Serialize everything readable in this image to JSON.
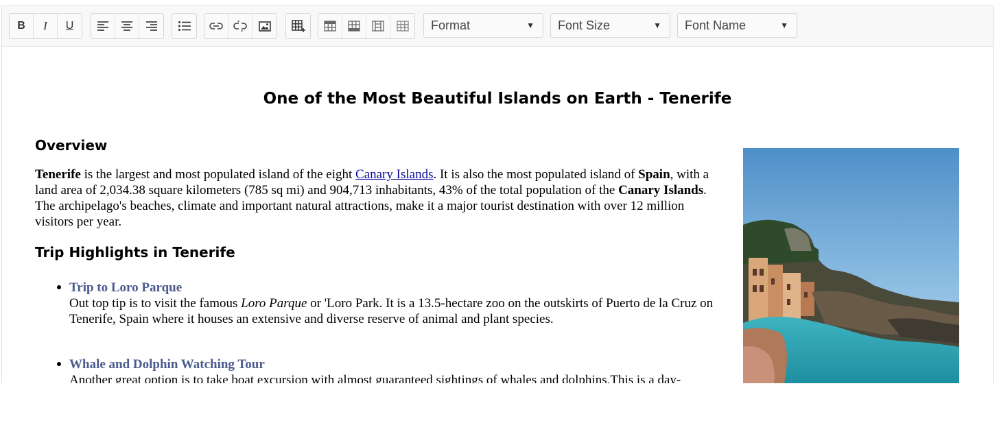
{
  "toolbar": {
    "format": {
      "label": "Format"
    },
    "font_size": {
      "label": "Font Size"
    },
    "font_name": {
      "label": "Font Name"
    },
    "buttons": {
      "bold": "B",
      "italic": "I",
      "underline": "U"
    }
  },
  "doc": {
    "title": "One of the Most Beautiful Islands on Earth - Tenerife",
    "overview": {
      "heading": "Overview",
      "p1_bold": "Tenerife",
      "p1_a": " is the largest and most populated island of the eight ",
      "p1_link": "Canary Islands",
      "p1_b": ". It is also the most populated island of ",
      "p1_bold2": "Spain",
      "p1_c": ", with a land area of 2,034.38 square kilometers (785 sq mi) and 904,713 inhabitants, 43% of the total population of the ",
      "p1_bold3": "Canary Islands",
      "p1_d": ". The archipelago's beaches, climate and important natural attractions, make it a major tourist destination with over 12 million visitors per year."
    },
    "highlights": {
      "heading": "Trip Highlights in Tenerife",
      "items": [
        {
          "title": "Trip to Loro Parque",
          "text_a": "Out top tip is to visit the famous ",
          "text_italic": "Loro Parque",
          "text_b": " or 'Loro Park. It is a 13.5-hectare zoo on the outskirts of Puerto de la Cruz on Tenerife, Spain where it houses an extensive and diverse reserve of animal and plant species."
        },
        {
          "title": "Whale and Dolphin Watching Tour",
          "text": "Another great option is to take boat excursion with almost guaranteed sightings of whales and dolphins.This is a day-"
        }
      ]
    }
  }
}
